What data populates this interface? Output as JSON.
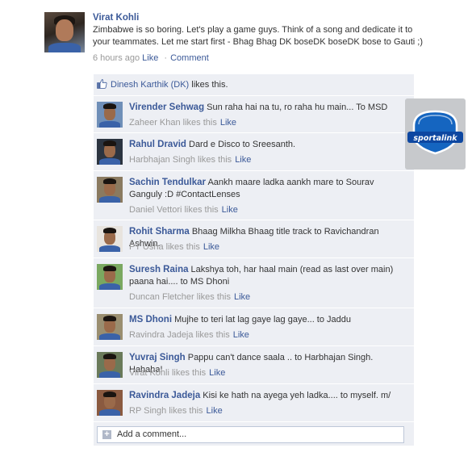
{
  "post": {
    "author": "Virat Kohli",
    "text": "Zimbabwe is so boring. Let's play a game guys. Think of a song and dedicate it to your teammates. Let me start first - Bhag Bhag DK boseDK boseDK bose to Gauti ;)",
    "time": "6 hours ago",
    "like_label": "Like",
    "comment_label": "Comment",
    "separator": "·"
  },
  "likes": {
    "name": "Dinesh Karthik (DK)",
    "suffix": " likes this."
  },
  "comments": [
    {
      "name": "Virender Sehwag",
      "text": " Sun raha hai na tu, ro raha hu main... To MSD",
      "liker": "Zaheer Khan likes this",
      "like_label": "Like"
    },
    {
      "name": "Rahul Dravid",
      "text": " Dard e Disco to Sreesanth.",
      "liker": "Harbhajan Singh likes this",
      "like_label": "Like"
    },
    {
      "name": "Sachin Tendulkar",
      "text": " Aankh maare ladka aankh mare to Sourav Ganguly :D #ContactLenses",
      "liker": "Daniel Vettori likes this",
      "like_label": "Like"
    },
    {
      "name": "Rohit Sharma",
      "text": " Bhaag Milkha Bhaag title track to Ravichandran Ashwin.",
      "liker": "PT Usha likes this",
      "like_label": "Like"
    },
    {
      "name": "Suresh Raina",
      "text": " Lakshya toh, har haal main (read as last over main) paana hai.... to MS Dhoni",
      "liker": "Duncan Fletcher likes this",
      "like_label": "Like"
    },
    {
      "name": "MS Dhoni",
      "text": " Mujhe to teri lat lag gaye lag gaye... to Jaddu",
      "liker": "Ravindra Jadeja likes this",
      "like_label": "Like"
    },
    {
      "name": "Yuvraj Singh",
      "text": " Pappu can't dance saala .. to Harbhajan Singh. Hahaha!",
      "liker": "Virat Kohli likes this",
      "like_label": "Like"
    },
    {
      "name": "Ravindra Jadeja",
      "text": " Kisi ke hath na ayega yeh ladka.... to myself. m/",
      "liker": "RP Singh likes this",
      "like_label": "Like"
    }
  ],
  "add_comment": {
    "placeholder": "Add a comment...",
    "plus": "+"
  },
  "badge": {
    "label": "sportalink",
    "color": "#1565c0"
  },
  "colors": {
    "link": "#3b5998",
    "panel": "#edeff4"
  }
}
